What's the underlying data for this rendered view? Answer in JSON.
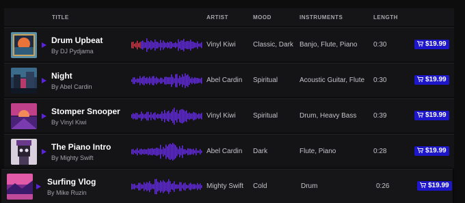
{
  "header": {
    "title": "TITLE",
    "artist": "ARTIST",
    "mood": "MOOD",
    "instruments": "INSTRUMENTS",
    "length": "LENGTH"
  },
  "tracks": [
    {
      "title": "Drum Upbeat",
      "by": "By DJ Pydjama",
      "artist": "Vinyl Kiwi",
      "mood": "Classic, Dark",
      "instruments": "Banjo, Flute, Piano",
      "length": "0:30",
      "price": "$19.99",
      "progress": 0.12
    },
    {
      "title": "Night",
      "by": "By Abel Cardin",
      "artist": "Abel Cardin",
      "mood": "Spiritual",
      "instruments": "Acoustic Guitar, Flute",
      "length": "0:30",
      "price": "$19.99",
      "progress": 0
    },
    {
      "title": "Stomper Snooper",
      "by": "By Vinyl Kiwi",
      "artist": "Vinyl Kiwi",
      "mood": "Spiritual",
      "instruments": "Drum, Heavy Bass",
      "length": "0:39",
      "price": "$19.99",
      "progress": 0
    },
    {
      "title": "The Piano Intro",
      "by": "By Mighty Swift",
      "artist": "Abel Cardin",
      "mood": "Dark",
      "instruments": "Flute, Piano",
      "length": "0:28",
      "price": "$19.99",
      "progress": 0
    },
    {
      "title": "Surfing Vlog",
      "by": "By Mike Ruzin",
      "artist": "Mighty Swift",
      "mood": "Cold",
      "instruments": "Drum",
      "length": "0:26",
      "price": "$19.99",
      "progress": 0
    }
  ],
  "colors": {
    "accent": "#5b22e0",
    "price_bg": "#1d17c9",
    "waveform": "#6a2cf0",
    "progress": "#e03a4a"
  },
  "icons": {
    "play": "play-icon",
    "cart": "cart-icon"
  }
}
